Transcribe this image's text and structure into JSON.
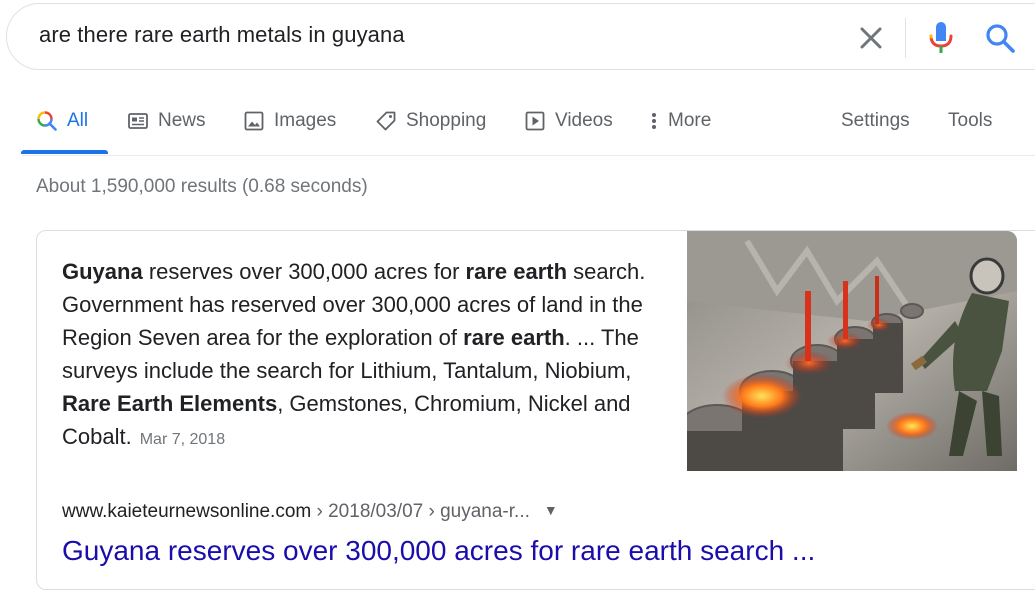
{
  "search": {
    "query": "are there rare earth metals in guyana"
  },
  "tabs": {
    "all": "All",
    "news": "News",
    "images": "Images",
    "shopping": "Shopping",
    "videos": "Videos",
    "more": "More",
    "settings": "Settings",
    "tools": "Tools"
  },
  "result_stats": "About 1,590,000 results (0.68 seconds)",
  "snippet": {
    "t1": "Guyana",
    "t2": " reserves over 300,000 acres for ",
    "t3": "rare earth",
    "t4": " search. Government has reserved over 300,000 acres of land in the Region Seven area for the exploration of ",
    "t5": "rare earth",
    "t6": ". ... The surveys include the search for Lithium, Tantalum, Niobium, ",
    "t7": "Rare Earth Elements",
    "t8": ", Gemstones, Chromium, Nickel and Cobalt.",
    "date": "Mar 7, 2018",
    "image_icon": "smelting-furnace-photo",
    "source_domain": "www.kaieteurnewsonline.com",
    "source_path": " › 2018/03/07 › guyana-r...",
    "title": "Guyana reserves over 300,000 acres for rare earth search ..."
  },
  "colors": {
    "link": "#1a0dab",
    "accent": "#1a73e8",
    "muted": "#70757a",
    "text": "#202124"
  }
}
